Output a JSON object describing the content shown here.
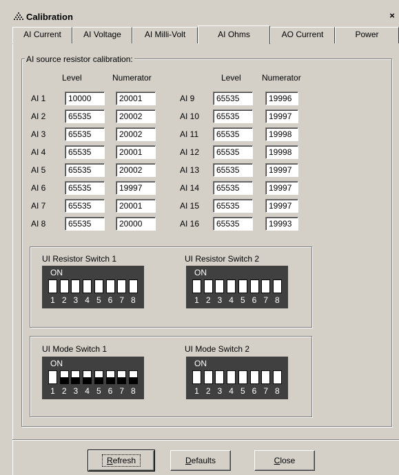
{
  "window": {
    "title": "Calibration",
    "close_glyph": "×",
    "app_icon": "calibration-app-icon"
  },
  "tabs": [
    {
      "label": "AI Current",
      "active": false
    },
    {
      "label": "AI Voltage",
      "active": false
    },
    {
      "label": "AI Milli-Volt",
      "active": false
    },
    {
      "label": "AI Ohms",
      "active": true
    },
    {
      "label": "AO Current",
      "active": false
    },
    {
      "label": "Power",
      "active": false
    }
  ],
  "resistor_group": {
    "legend": "AI source resistor calibration:",
    "col_level": "Level",
    "col_numerator": "Numerator",
    "left_rows": [
      {
        "label": "AI 1",
        "level": "10000",
        "numerator": "20001"
      },
      {
        "label": "AI 2",
        "level": "65535",
        "numerator": "20002"
      },
      {
        "label": "AI 3",
        "level": "65535",
        "numerator": "20002"
      },
      {
        "label": "AI 4",
        "level": "65535",
        "numerator": "20001"
      },
      {
        "label": "AI 5",
        "level": "65535",
        "numerator": "20002"
      },
      {
        "label": "AI 6",
        "level": "65535",
        "numerator": "19997"
      },
      {
        "label": "AI 7",
        "level": "65535",
        "numerator": "20001"
      },
      {
        "label": "AI 8",
        "level": "65535",
        "numerator": "20000"
      }
    ],
    "right_rows": [
      {
        "label": "AI 9",
        "level": "65535",
        "numerator": "19996"
      },
      {
        "label": "AI 10",
        "level": "65535",
        "numerator": "19997"
      },
      {
        "label": "AI 11",
        "level": "65535",
        "numerator": "19998"
      },
      {
        "label": "AI 12",
        "level": "65535",
        "numerator": "19998"
      },
      {
        "label": "AI 13",
        "level": "65535",
        "numerator": "19997"
      },
      {
        "label": "AI 14",
        "level": "65535",
        "numerator": "19997"
      },
      {
        "label": "AI 15",
        "level": "65535",
        "numerator": "19997"
      },
      {
        "label": "AI 16",
        "level": "65535",
        "numerator": "19993"
      }
    ]
  },
  "switches": {
    "on_label": "ON",
    "positions": [
      "1",
      "2",
      "3",
      "4",
      "5",
      "6",
      "7",
      "8"
    ],
    "resistor_switch_1": {
      "label": "UI Resistor Switch 1",
      "states": [
        "off",
        "off",
        "off",
        "off",
        "off",
        "off",
        "off",
        "off"
      ]
    },
    "resistor_switch_2": {
      "label": "UI Resistor Switch 2",
      "states": [
        "off",
        "off",
        "off",
        "off",
        "off",
        "off",
        "off",
        "off"
      ]
    },
    "mode_switch_1": {
      "label": "UI Mode Switch 1",
      "states": [
        "off",
        "on",
        "on",
        "on",
        "on",
        "on",
        "on",
        "on"
      ]
    },
    "mode_switch_2": {
      "label": "UI Mode Switch 2",
      "states": [
        "off",
        "off",
        "off",
        "off",
        "off",
        "off",
        "off",
        "off"
      ]
    }
  },
  "buttons": {
    "refresh": {
      "label_prefix": "",
      "accel": "R",
      "label_rest": "efresh"
    },
    "defaults": {
      "label_prefix": "",
      "accel": "D",
      "label_rest": "efaults"
    },
    "close": {
      "label_prefix": "",
      "accel": "C",
      "label_rest": "lose"
    }
  }
}
